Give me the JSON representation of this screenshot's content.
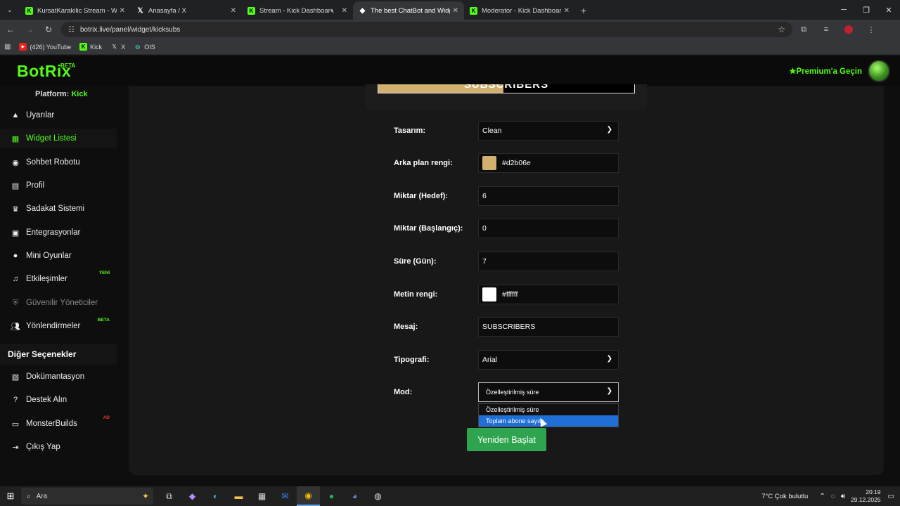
{
  "browser": {
    "tabs": [
      {
        "title": "KursatKarakilic Stream - Watch",
        "icon": "kick"
      },
      {
        "title": "Anasayfa / X",
        "icon": "x"
      },
      {
        "title": "Stream - Kick Dashboard",
        "icon": "kick"
      },
      {
        "title": "The best ChatBot and Widgets",
        "icon": "botrix",
        "active": true
      },
      {
        "title": "Moderator - Kick Dashboard",
        "icon": "kick"
      }
    ],
    "url": "botrix.live/panel/widget/kicksubs",
    "bookmarks": [
      {
        "label": "(426) YouTube",
        "icon": "youtube"
      },
      {
        "label": "Kick",
        "icon": "kick"
      },
      {
        "label": "X",
        "icon": "x"
      },
      {
        "label": "OIS",
        "icon": "ois"
      }
    ]
  },
  "header": {
    "logo": "BotRix",
    "logo_badge": "BETA",
    "premium_label": "Premium'a Geçin"
  },
  "sidebar": {
    "platform_label": "Platform:",
    "platform_value": "Kick",
    "items": [
      {
        "label": "Uyarılar",
        "icon": "warning-icon"
      },
      {
        "label": "Widget Listesi",
        "icon": "grid-icon",
        "active": true
      },
      {
        "label": "Sohbet Robotu",
        "icon": "robot-icon"
      },
      {
        "label": "Profil",
        "icon": "id-card-icon"
      },
      {
        "label": "Sadakat Sistemi",
        "icon": "trophy-icon"
      },
      {
        "label": "Entegrasyonlar",
        "icon": "integration-icon"
      },
      {
        "label": "Mini Oyunlar",
        "icon": "gamepad-icon"
      },
      {
        "label": "Etkileşimler",
        "icon": "music-icon",
        "badge": "YENİ"
      },
      {
        "label": "Güvenilir Yöneticiler",
        "icon": "shield-icon",
        "disabled": true
      },
      {
        "label": "Yönlendirmeler",
        "icon": "users-icon",
        "badge": "BETA"
      }
    ],
    "section_title": "Diğer Seçenekler",
    "other_items": [
      {
        "label": "Dokümantasyon",
        "icon": "scroll-icon"
      },
      {
        "label": "Destek Alın",
        "icon": "question-icon"
      },
      {
        "label": "MonsterBuilds",
        "icon": "laptop-icon",
        "badge": "AD"
      },
      {
        "label": "Çıkış Yap",
        "icon": "logout-icon"
      }
    ]
  },
  "preview": {
    "text": "SUBSCRIBERS",
    "progress_fraction": 0.49,
    "fill_color": "#d2b06e"
  },
  "form": {
    "design_label": "Tasarım:",
    "design_value": "Clean",
    "bg_color_label": "Arka plan rengi:",
    "bg_color_value": "#d2b06e",
    "goal_label": "Miktar (Hedef):",
    "goal_value": "6",
    "start_label": "Miktar (Başlangıç):",
    "start_value": "0",
    "duration_label": "Süre (Gün):",
    "duration_value": "7",
    "text_color_label": "Metin rengi:",
    "text_color_value": "#ffffff",
    "message_label": "Mesaj:",
    "message_value": "SUBSCRIBERS",
    "font_label": "Tipografi:",
    "font_value": "Arial",
    "mode_label": "Mod:",
    "mode_value": "Özelleştirilmiş süre",
    "mode_options": [
      "Özelleştirilmiş süre",
      "Toplam abone sayısı"
    ],
    "mode_highlighted": "Toplam abone sayısı",
    "restart_button": "Yeniden Başlat"
  },
  "taskbar": {
    "search_placeholder": "Ara",
    "weather": "7°C  Çok bulutlu",
    "time": "20:19",
    "date": "29.12.2025"
  }
}
